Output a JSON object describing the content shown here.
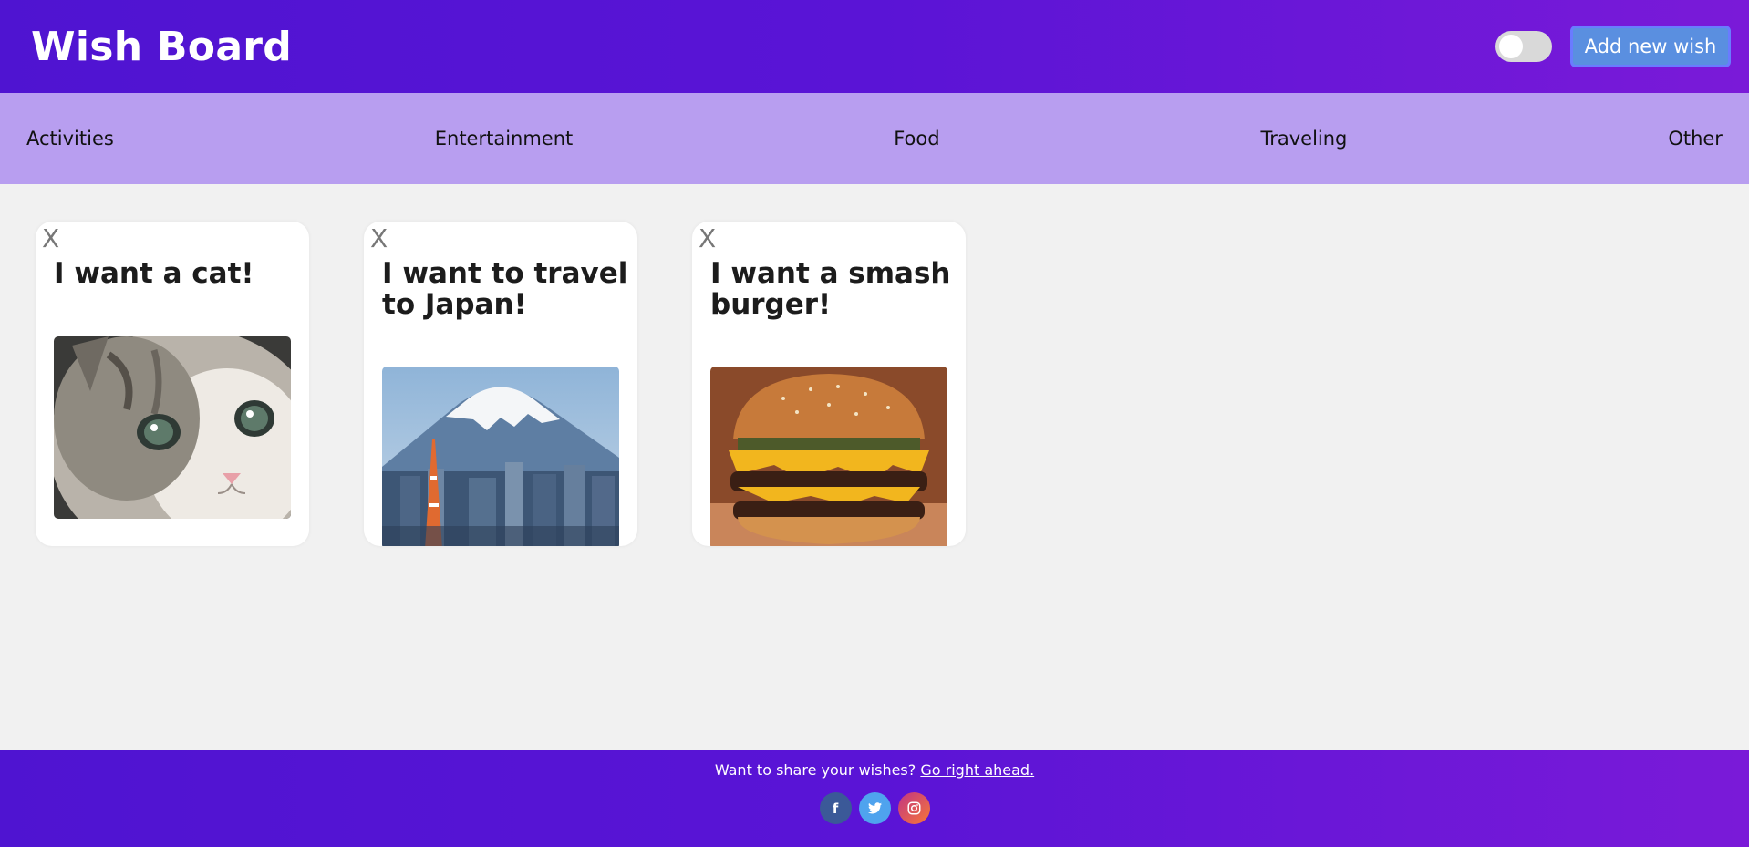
{
  "header": {
    "title": "Wish Board",
    "add_button_label": "Add new wish",
    "theme_toggle": "off"
  },
  "categories": [
    "Activities",
    "Entertainment",
    "Food",
    "Traveling",
    "Other"
  ],
  "cards": [
    {
      "close_label": "X",
      "title": "I want a cat!",
      "image": "kitten photo"
    },
    {
      "close_label": "X",
      "title": "I want to travel to Japan!",
      "image": "Mount Fuji with Tokyo Tower photo"
    },
    {
      "close_label": "X",
      "title": "I want a smash burger!",
      "image": "double cheeseburger photo"
    }
  ],
  "footer": {
    "text": "Want to share your wishes?",
    "link_text": "Go right ahead.",
    "social": [
      {
        "name": "facebook-icon",
        "glyph": "f"
      },
      {
        "name": "twitter-icon",
        "glyph": "t"
      },
      {
        "name": "instagram-icon",
        "glyph": "◎"
      }
    ]
  },
  "colors": {
    "header_gradient_start": "#4f14d1",
    "header_gradient_end": "#7a1ad8",
    "category_bar": "#b89ef0",
    "add_button": "#5a8fe0",
    "background": "#f1f1f1"
  }
}
